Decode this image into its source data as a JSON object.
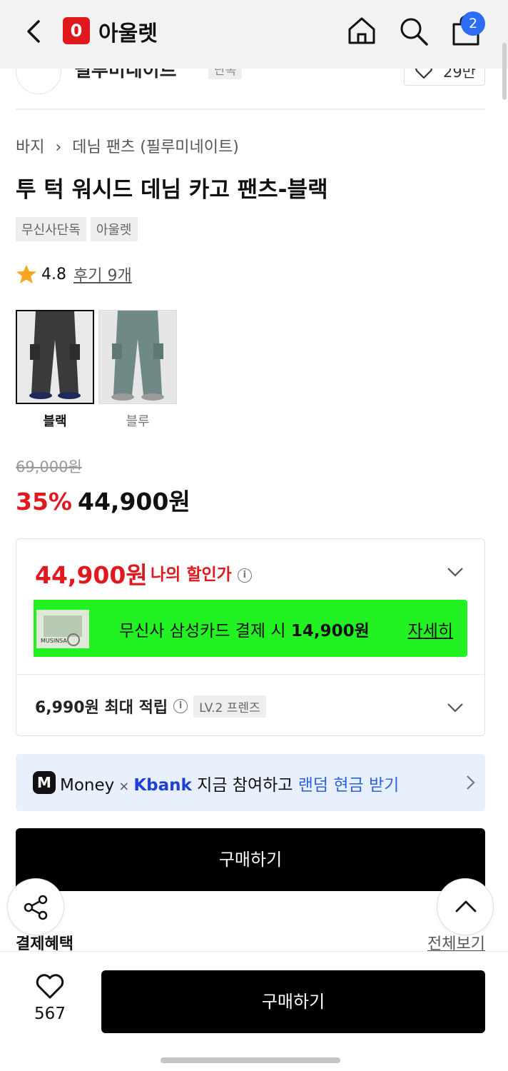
{
  "header": {
    "back_icon": "chevron-left-icon",
    "logo_badge": "0",
    "app_name": "아울렛",
    "cart_count": "2"
  },
  "brand": {
    "name": "필루미네이트",
    "tag": "단독",
    "like_count": "29만"
  },
  "breadcrumb": {
    "category": "바지",
    "subcategory": "데님 팬츠 (필루미네이트)"
  },
  "product": {
    "title": "투 턱 워시드 데님 카고 팬츠-블랙",
    "tags": [
      "무신사단독",
      "아울렛"
    ],
    "rating": "4.8",
    "reviews": "후기 9개",
    "variants": [
      {
        "label": "블랙",
        "selected": true,
        "color": "#3a3a3a"
      },
      {
        "label": "블루",
        "selected": false,
        "color": "#6f8a86"
      }
    ],
    "original_price": "69,000원",
    "discount_pct": "35%",
    "sale_price": "44,900원"
  },
  "benefits": {
    "my_price": "44,900원",
    "my_price_label": "나의 할인가",
    "card_text": "무신사 삼성카드 결제 시",
    "card_price": "14,900원",
    "card_detail": "자세히",
    "card_img_text": "MUSINSA",
    "points_text": "6,990원 최대 적립",
    "level_tag": "LV.2 프렌즈"
  },
  "money_banner": {
    "m_badge": "M",
    "money": "Money",
    "times": "×",
    "kbank": "Kbank",
    "text": "지금 참여하고",
    "link": "랜덤 현금 받기"
  },
  "buy_mid": "구매하기",
  "payment_benefits": {
    "heading": "결제혜택",
    "see_all": "전체보기"
  },
  "bottom_bar": {
    "like_count": "567",
    "buy_label": "구매하기"
  },
  "colors": {
    "accent_red": "#e0191f",
    "card_green": "#22f222",
    "badge_blue": "#2d6cf5",
    "link_blue": "#2a62e6"
  }
}
